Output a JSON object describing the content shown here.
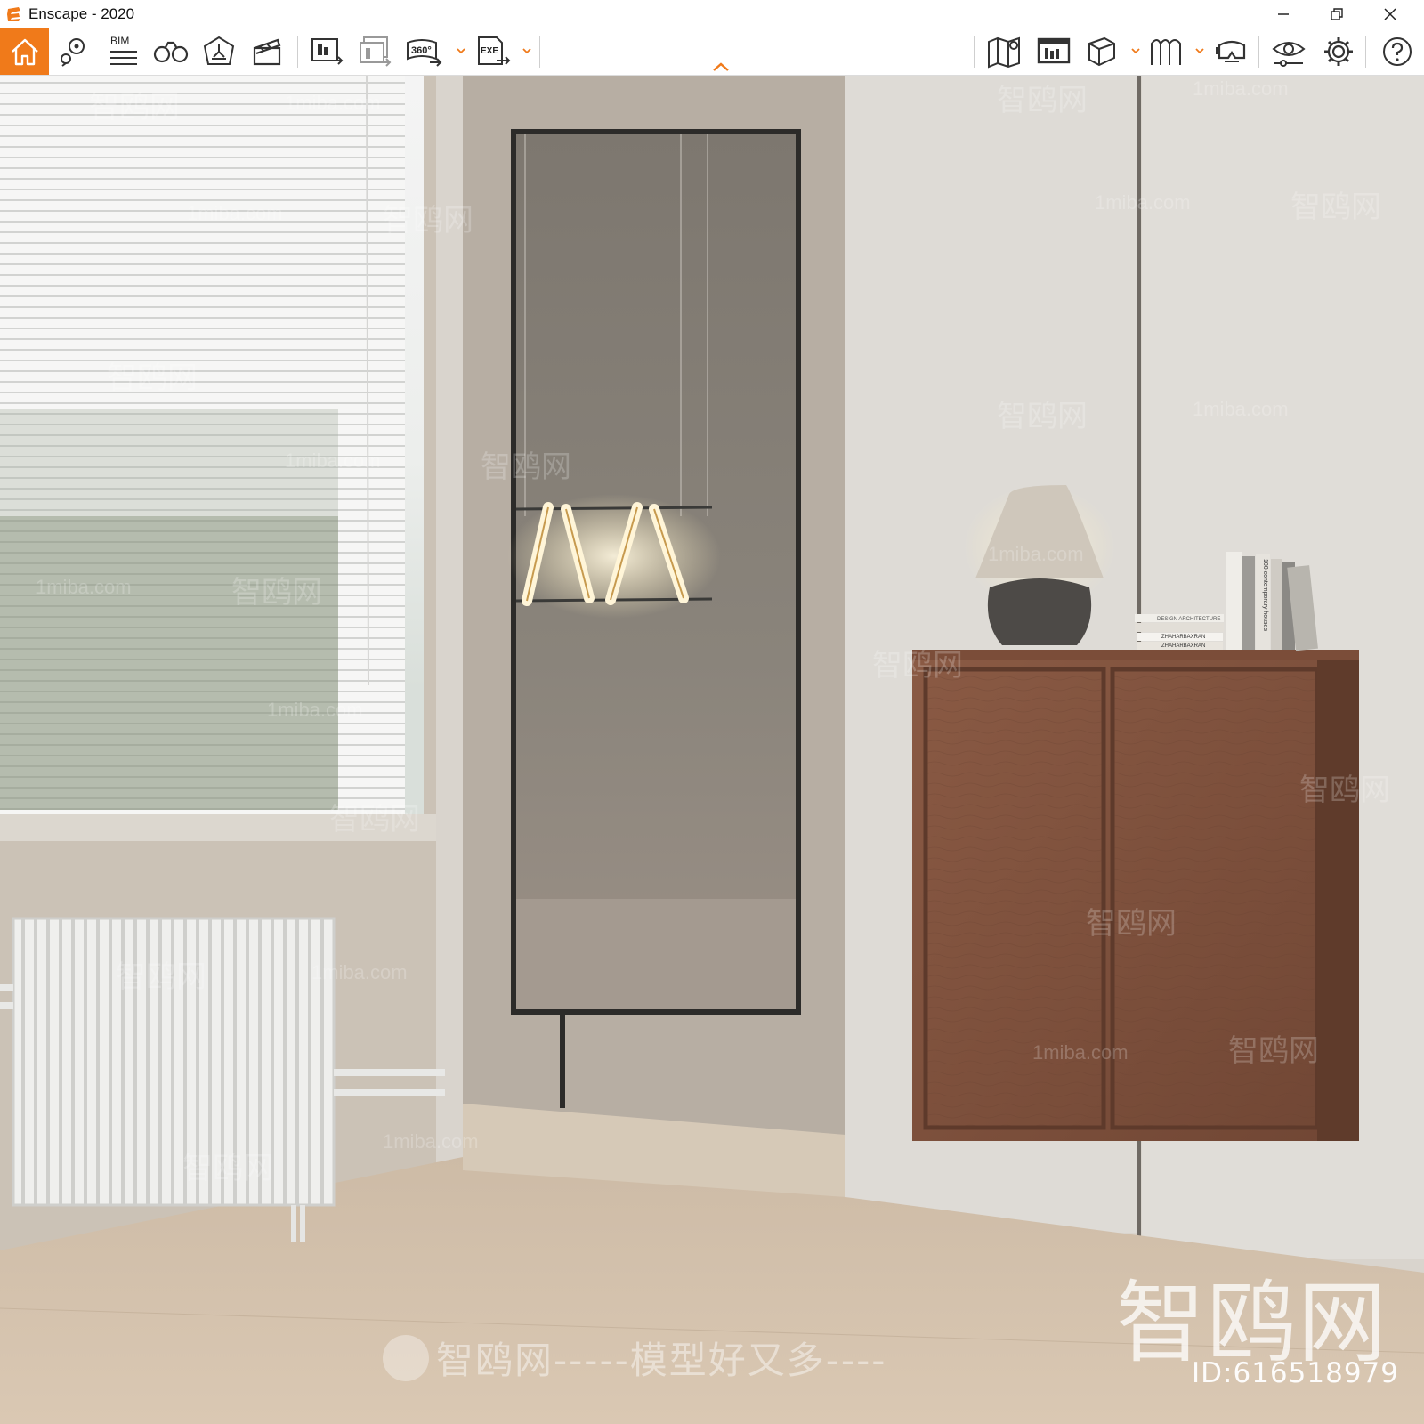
{
  "window": {
    "title": "Enscape - 2020",
    "controls": [
      "minimize-icon",
      "restore-icon",
      "close-icon"
    ]
  },
  "toolbar": {
    "left_buttons": [
      {
        "icon": "home-icon",
        "active": true
      },
      {
        "icon": "location-pin-icon"
      },
      {
        "icon": "bim-icon",
        "label": "BIM"
      },
      {
        "icon": "binoculars-icon"
      },
      {
        "icon": "light-view-icon"
      },
      {
        "icon": "clapperboard-icon"
      }
    ],
    "export_buttons": [
      {
        "icon": "screenshot-export-icon"
      },
      {
        "icon": "batch-export-icon"
      },
      {
        "icon": "panorama-360-icon",
        "label": "360°",
        "dropdown": true
      },
      {
        "icon": "exe-export-icon",
        "label": "EXE",
        "dropdown": true
      }
    ],
    "right_buttons": [
      {
        "icon": "map-icon"
      },
      {
        "icon": "asset-library-icon"
      },
      {
        "icon": "cube-view-icon",
        "dropdown": true
      },
      {
        "icon": "materials-icon",
        "dropdown": true
      },
      {
        "icon": "vr-headset-icon"
      },
      {
        "icon": "visual-settings-icon"
      },
      {
        "icon": "gear-icon"
      },
      {
        "icon": "help-icon"
      }
    ],
    "accent_color": "#f07a1a"
  },
  "viewport": {
    "watermarks": {
      "site_text": "1miba.com",
      "brand_text": "智鸥网",
      "bottom_banner": "智鸥网-----模型好又多----",
      "big_logo": "智鸥网",
      "id_text": "ID:616518979"
    },
    "book_spines": [
      "DESIGN ARCHITECTURE",
      "ZHAHARBAXRAN",
      "ZHAHARBAXRAN",
      "100 contemporary houses"
    ]
  }
}
